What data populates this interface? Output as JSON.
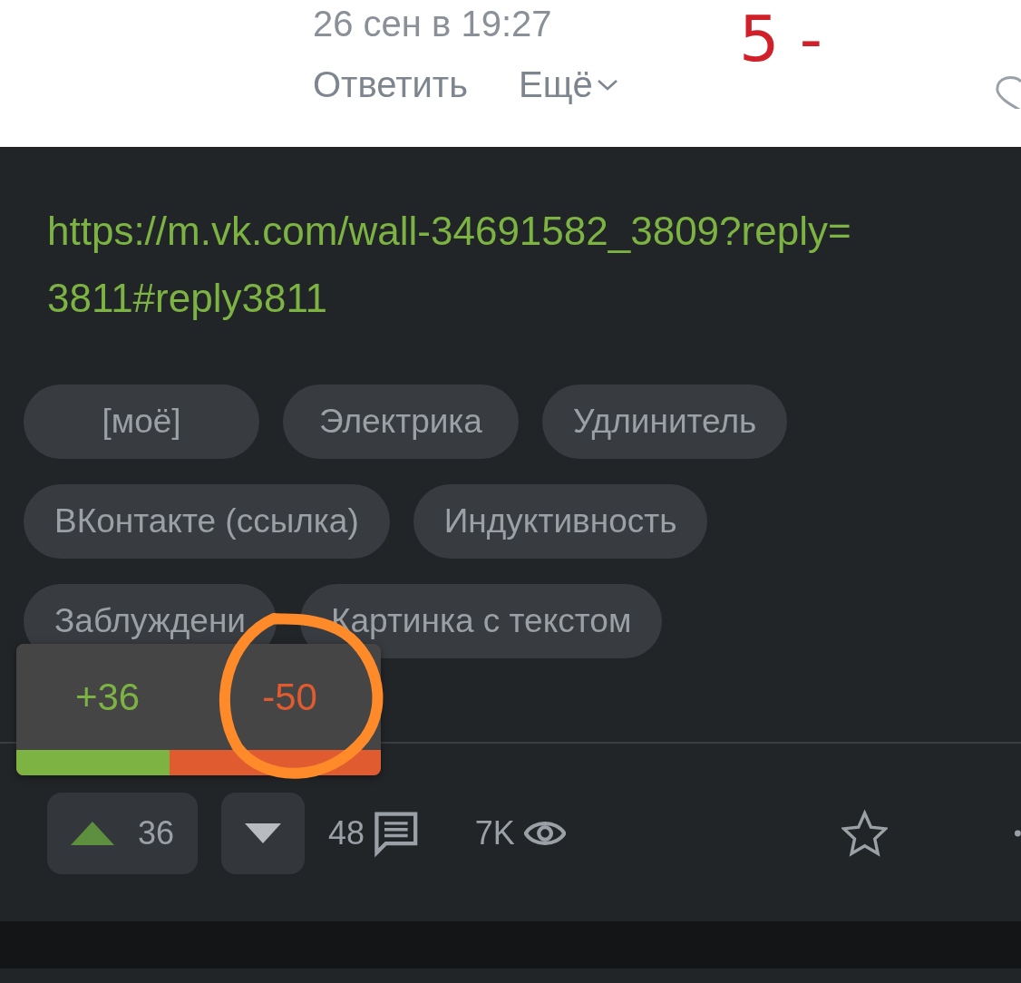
{
  "comment_meta": {
    "date": "26 сен в 19:27",
    "reply": "Ответить",
    "more": "Ещё"
  },
  "annotation": {
    "text": "5 -"
  },
  "post": {
    "link_lines": [
      "https://m.vk.com/wall-34691582_3809?reply=",
      "3811#reply3811"
    ],
    "tags": [
      [
        "[моё]",
        "Электрика",
        "Удлинитель"
      ],
      [
        "ВКонтакте (ссылка)",
        "Индуктивность"
      ],
      [
        "Заблуждени",
        "Картинка с текстом"
      ]
    ]
  },
  "rating_popup": {
    "plus": "+36",
    "minus": "-50",
    "level": 0.42
  },
  "actions": {
    "upvotes": "36",
    "comments": "48",
    "views": "7K"
  }
}
